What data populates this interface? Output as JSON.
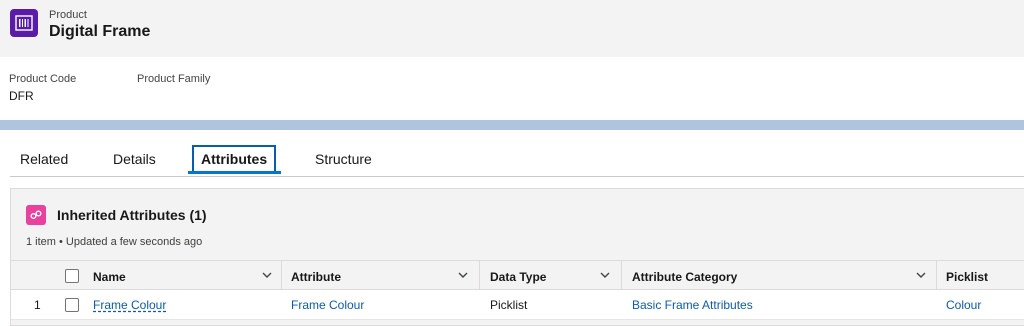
{
  "record": {
    "object_type": "Product",
    "name": "Digital Frame",
    "icon": "product-barcode-icon",
    "icon_color": "#5a1ba9"
  },
  "highlights": {
    "fields": [
      {
        "label": "Product Code",
        "value": "DFR"
      },
      {
        "label": "Product Family",
        "value": ""
      }
    ]
  },
  "tabs": [
    {
      "label": "Related",
      "active": false
    },
    {
      "label": "Details",
      "active": false
    },
    {
      "label": "Attributes",
      "active": true
    },
    {
      "label": "Structure",
      "active": false
    }
  ],
  "related_list": {
    "title": "Inherited Attributes (1)",
    "meta": "1 item • Updated a few seconds ago",
    "icon": "attributes-icon",
    "icon_color": "#e9429e",
    "columns": [
      "Name",
      "Attribute",
      "Data Type",
      "Attribute Category",
      "Picklist"
    ],
    "rows": [
      {
        "row_number": "1",
        "name": "Frame Colour",
        "attribute": "Frame Colour",
        "data_type": "Picklist",
        "attribute_category": "Basic Frame Attributes",
        "picklist": "Colour"
      }
    ]
  },
  "colors": {
    "accent": "#0176d3",
    "link": "#0b5cab",
    "band": "#b0c4df"
  }
}
